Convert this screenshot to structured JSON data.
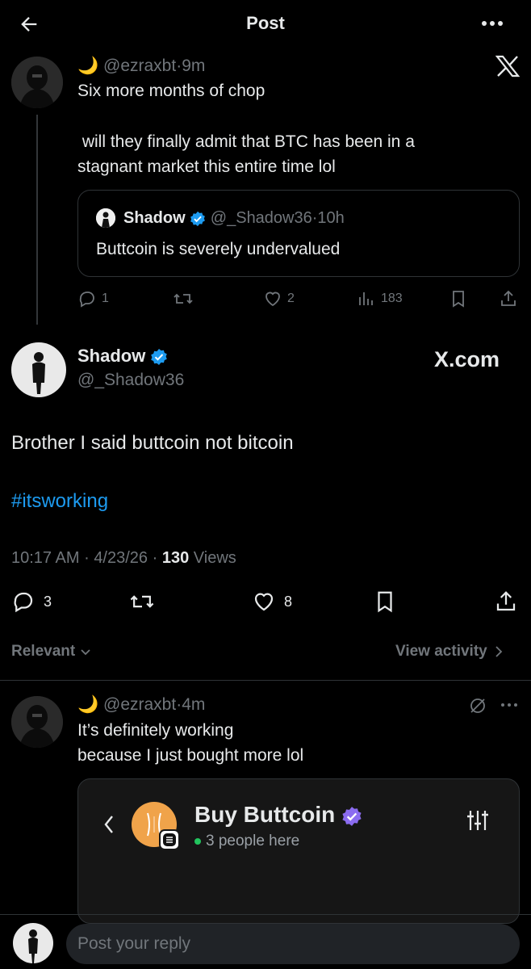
{
  "header": {
    "title": "Post"
  },
  "parent_post": {
    "moon": "🌙",
    "handle": "@ezraxbt",
    "dot": "·",
    "time": "9m",
    "line1": "Six more months of chop",
    "line2": " will they finally admit that BTC has been in a",
    "line3": "stagnant market this entire time lol",
    "quote": {
      "name": "Shadow",
      "handle": "@_Shadow36",
      "dot": "·",
      "time": "10h",
      "text": "Buttcoin is severely undervalued"
    },
    "actions": {
      "replies": "1",
      "likes": "2",
      "views": "183"
    }
  },
  "main_post": {
    "name": "Shadow",
    "handle": "@_Shadow36",
    "watermark": "X.com",
    "text": "Brother I said buttcoin not bitcoin",
    "hashtag": "#itsworking",
    "time": "10:17 AM",
    "date": "4/23/26",
    "dot": "·",
    "views_count": "130",
    "views_label": "Views",
    "actions": {
      "replies": "3",
      "likes": "8"
    }
  },
  "sort": {
    "label": "Relevant",
    "activity": "View activity"
  },
  "reply": {
    "moon": "🌙",
    "handle": "@ezraxbt",
    "dot": "·",
    "time": "4m",
    "line1": "It’s definitely working",
    "line2": "because I just bought more lol",
    "embed": {
      "title": "Buy Buttcoin",
      "people": "3 people here"
    }
  },
  "composer": {
    "placeholder": "Post your reply"
  },
  "colors": {
    "accent": "#1d9bf0",
    "verified": "#1d9bf0",
    "purple_verified": "#8b6cf0",
    "online": "#22c55e"
  }
}
